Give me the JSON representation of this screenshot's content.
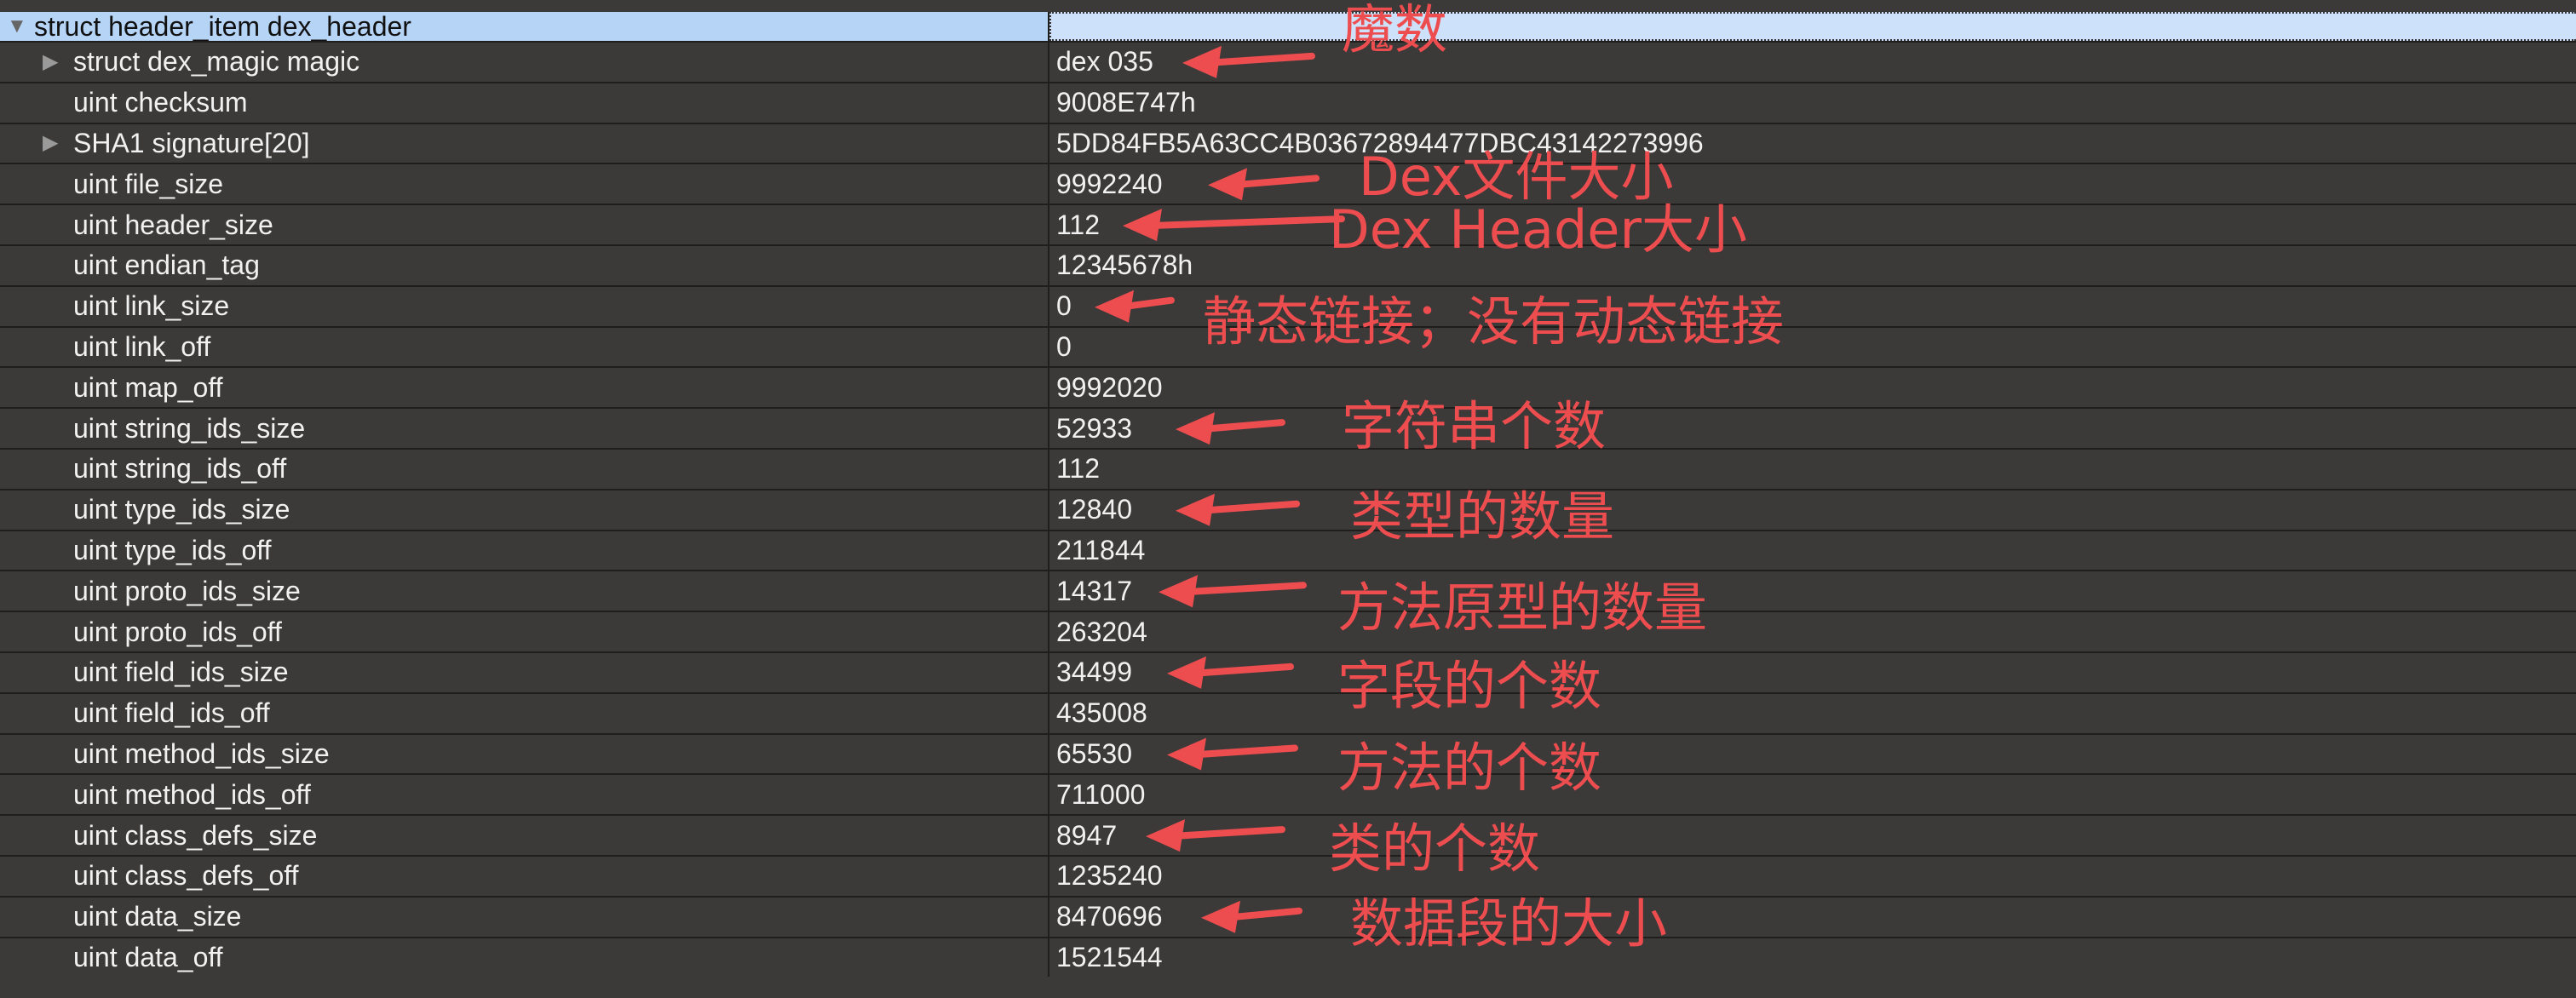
{
  "tree": {
    "root": {
      "name": "struct header_item dex_header",
      "value": "",
      "expanded_icon": "triangle-down-icon"
    },
    "rows": [
      {
        "name": "struct dex_magic magic",
        "value": "dex 035",
        "expandable": true
      },
      {
        "name": "uint checksum",
        "value": "9008E747h",
        "expandable": false
      },
      {
        "name": "SHA1 signature[20]",
        "value": "5DD84FB5A63CC4B03672894477DBC43142273996",
        "expandable": true
      },
      {
        "name": "uint file_size",
        "value": "9992240",
        "expandable": false
      },
      {
        "name": "uint header_size",
        "value": "112",
        "expandable": false
      },
      {
        "name": "uint endian_tag",
        "value": "12345678h",
        "expandable": false
      },
      {
        "name": "uint link_size",
        "value": "0",
        "expandable": false
      },
      {
        "name": "uint link_off",
        "value": "0",
        "expandable": false
      },
      {
        "name": "uint map_off",
        "value": "9992020",
        "expandable": false
      },
      {
        "name": "uint string_ids_size",
        "value": "52933",
        "expandable": false
      },
      {
        "name": "uint string_ids_off",
        "value": "112",
        "expandable": false
      },
      {
        "name": "uint type_ids_size",
        "value": "12840",
        "expandable": false
      },
      {
        "name": "uint type_ids_off",
        "value": "211844",
        "expandable": false
      },
      {
        "name": "uint proto_ids_size",
        "value": "14317",
        "expandable": false
      },
      {
        "name": "uint proto_ids_off",
        "value": "263204",
        "expandable": false
      },
      {
        "name": "uint field_ids_size",
        "value": "34499",
        "expandable": false
      },
      {
        "name": "uint field_ids_off",
        "value": "435008",
        "expandable": false
      },
      {
        "name": "uint method_ids_size",
        "value": "65530",
        "expandable": false
      },
      {
        "name": "uint method_ids_off",
        "value": "711000",
        "expandable": false
      },
      {
        "name": "uint class_defs_size",
        "value": "8947",
        "expandable": false
      },
      {
        "name": "uint class_defs_off",
        "value": "1235240",
        "expandable": false
      },
      {
        "name": "uint data_size",
        "value": "8470696",
        "expandable": false
      },
      {
        "name": "uint data_off",
        "value": "1521544",
        "expandable": false
      }
    ]
  },
  "annotations": {
    "color": "#ee4d4f",
    "items": [
      {
        "label": "魔数",
        "target": "dex 035"
      },
      {
        "label": "Dex文件大小",
        "target": "9992240"
      },
      {
        "label": "Dex Header大小",
        "target": "112"
      },
      {
        "label": "静态链接；没有动态链接",
        "target": "0"
      },
      {
        "label": "字符串个数",
        "target": "52933"
      },
      {
        "label": "类型的数量",
        "target": "12840"
      },
      {
        "label": "方法原型的数量",
        "target": "14317"
      },
      {
        "label": "字段的个数",
        "target": "34499"
      },
      {
        "label": "方法的个数",
        "target": "65530"
      },
      {
        "label": "类的个数",
        "target": "8947"
      },
      {
        "label": "数据段的大小",
        "target": "8470696"
      }
    ]
  },
  "colors": {
    "row_bg": "#3c3a39",
    "row_border": "#1f1e1d",
    "header_bg": "#b6d4f6",
    "text": "#f1f1f1",
    "annotation": "#ee4d4f"
  }
}
